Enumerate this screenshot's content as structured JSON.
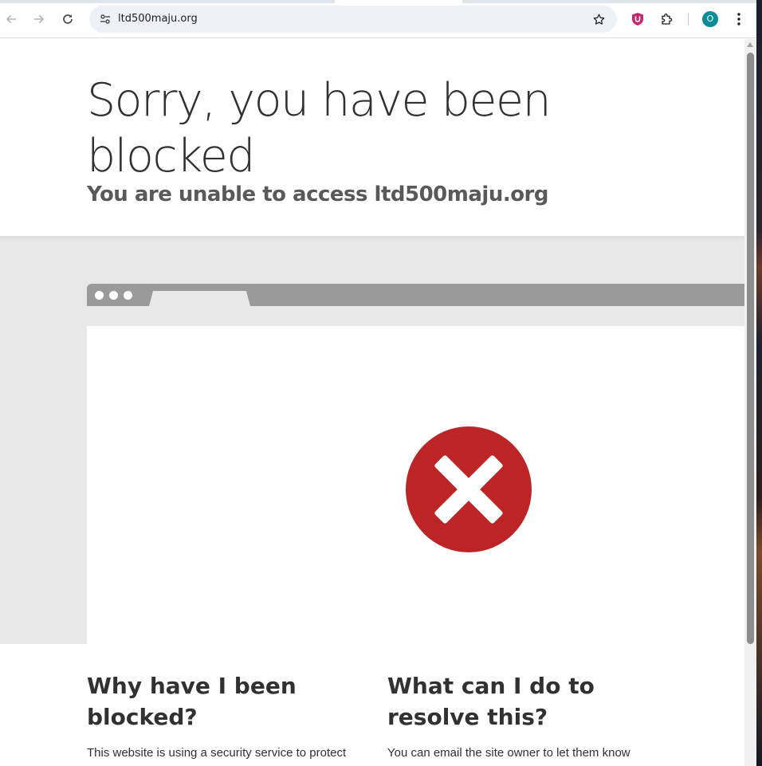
{
  "browser": {
    "url": "ltd500maju.org",
    "profile_initial": "O",
    "icons": {
      "back": "arrow-left-icon",
      "forward": "arrow-right-icon",
      "reload": "reload-icon",
      "site_info": "tune-icon",
      "bookmark": "star-icon",
      "extension_shield": "ublock-shield-icon",
      "extensions": "puzzle-icon",
      "menu": "kebab-menu-icon"
    },
    "colors": {
      "omnibox_bg": "#eef1f8",
      "avatar_bg": "#0b8c96",
      "extension_shield": "#c6286e"
    }
  },
  "page": {
    "headline": "Sorry, you have been blocked",
    "subheadline": "You are unable to access ltd500maju.org",
    "illustration": {
      "icon": "error-x-icon",
      "color": "#bd2426"
    },
    "sections": [
      {
        "title": "Why have I been blocked?",
        "text": "This website is using a security service to protect"
      },
      {
        "title": "What can I do to resolve this?",
        "text": "You can email the site owner to let them know"
      }
    ]
  }
}
